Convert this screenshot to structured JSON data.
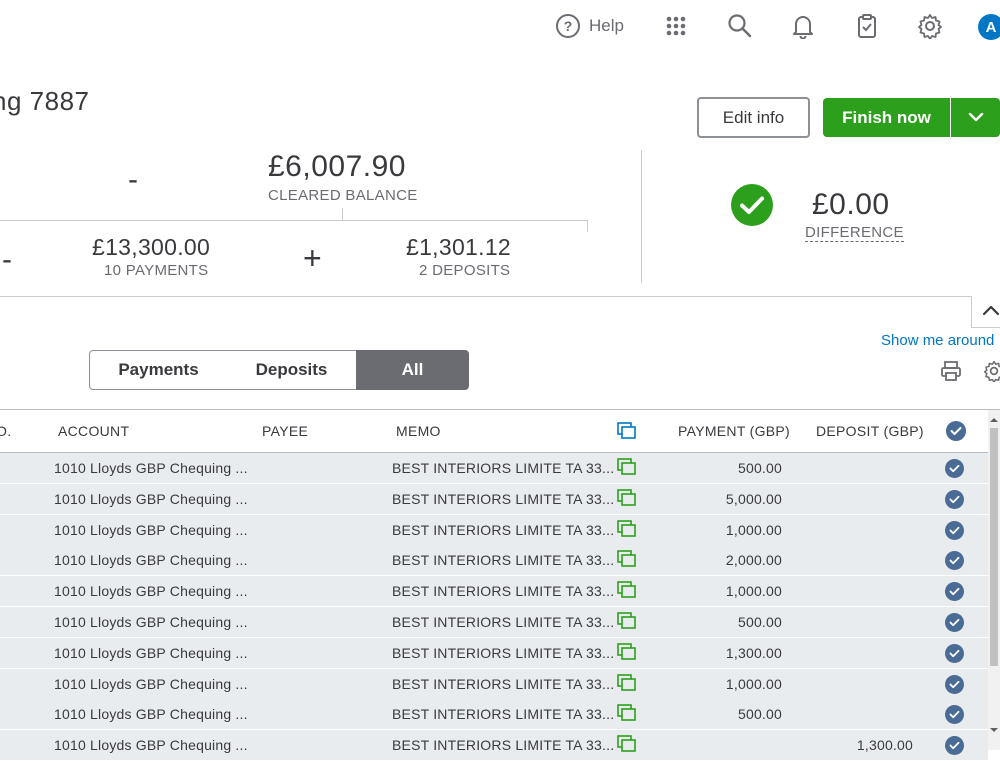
{
  "topbar": {
    "help_label": "Help",
    "avatar_initial": "A",
    "icons": [
      "help-circle-icon",
      "apps-grid-icon",
      "search-icon",
      "bell-icon",
      "clipboard-check-icon",
      "gear-icon"
    ]
  },
  "page": {
    "title": "ng 7887"
  },
  "actions": {
    "edit_label": "Edit info",
    "finish_label": "Finish now"
  },
  "summary": {
    "minus_top": "-",
    "cleared_balance": "£6,007.90",
    "cleared_caption": "CLEARED BALANCE",
    "minus_left": "-",
    "payments_amount": "£13,300.00",
    "payments_caption": "10 PAYMENTS",
    "plus": "+",
    "deposits_amount": "£1,301.12",
    "deposits_caption": "2 DEPOSITS",
    "difference_amount": "£0.00",
    "difference_caption": "DIFFERENCE"
  },
  "links": {
    "show_me_around": "Show me around"
  },
  "filters": {
    "tabs": [
      {
        "label": "Payments",
        "active": false
      },
      {
        "label": "Deposits",
        "active": false
      },
      {
        "label": "All",
        "active": true
      }
    ]
  },
  "table": {
    "headers": {
      "no": "O.",
      "account": "ACCOUNT",
      "payee": "PAYEE",
      "memo": "MEMO",
      "payment": "PAYMENT (GBP)",
      "deposit": "DEPOSIT (GBP)"
    },
    "rows": [
      {
        "account": "1010 Lloyds GBP Chequing ...",
        "payee": "",
        "memo": "BEST INTERIORS LIMITE TA 33...",
        "payment": "500.00",
        "deposit": ""
      },
      {
        "account": "1010 Lloyds GBP Chequing ...",
        "payee": "",
        "memo": "BEST INTERIORS LIMITE TA 33...",
        "payment": "5,000.00",
        "deposit": ""
      },
      {
        "account": "1010 Lloyds GBP Chequing ...",
        "payee": "",
        "memo": "BEST INTERIORS LIMITE TA 33...",
        "payment": "1,000.00",
        "deposit": ""
      },
      {
        "account": "1010 Lloyds GBP Chequing ...",
        "payee": "",
        "memo": "BEST INTERIORS LIMITE TA 33...",
        "payment": "2,000.00",
        "deposit": ""
      },
      {
        "account": "1010 Lloyds GBP Chequing ...",
        "payee": "",
        "memo": "BEST INTERIORS LIMITE TA 33...",
        "payment": "1,000.00",
        "deposit": ""
      },
      {
        "account": "1010 Lloyds GBP Chequing ...",
        "payee": "",
        "memo": "BEST INTERIORS LIMITE TA 33...",
        "payment": "500.00",
        "deposit": ""
      },
      {
        "account": "1010 Lloyds GBP Chequing ...",
        "payee": "",
        "memo": "BEST INTERIORS LIMITE TA 33...",
        "payment": "1,300.00",
        "deposit": ""
      },
      {
        "account": "1010 Lloyds GBP Chequing ...",
        "payee": "",
        "memo": "BEST INTERIORS LIMITE TA 33...",
        "payment": "1,000.00",
        "deposit": ""
      },
      {
        "account": "1010 Lloyds GBP Chequing ...",
        "payee": "",
        "memo": "BEST INTERIORS LIMITE TA 33...",
        "payment": "500.00",
        "deposit": ""
      },
      {
        "account": "1010 Lloyds GBP Chequing ...",
        "payee": "",
        "memo": "BEST INTERIORS LIMITE TA 33...",
        "payment": "",
        "deposit": "1,300.00"
      }
    ]
  },
  "colors": {
    "primary_green": "#2ca01c",
    "check_blue": "#4a6b95",
    "link_blue": "#0077c5",
    "row_bg": "#e9ecef"
  }
}
